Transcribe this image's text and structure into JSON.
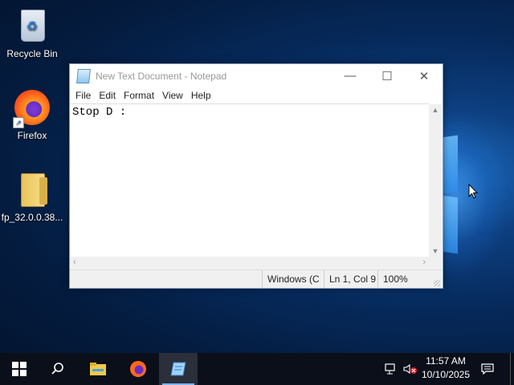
{
  "desktop": {
    "icons": [
      {
        "label": "Recycle Bin",
        "icon": "recycle-bin-icon"
      },
      {
        "label": "Firefox",
        "icon": "firefox-icon"
      },
      {
        "label": "fp_32.0.0.38...",
        "icon": "folder-icon"
      }
    ]
  },
  "notepad": {
    "title": "New Text Document - Notepad",
    "menu": [
      "File",
      "Edit",
      "Format",
      "View",
      "Help"
    ],
    "content": "Stop D :",
    "status": {
      "encoding": "Windows (C",
      "position": "Ln 1, Col 9",
      "zoom": "100%"
    },
    "controls": {
      "minimize": "—",
      "maximize": "☐",
      "close": "✕"
    }
  },
  "taskbar": {
    "buttons": [
      "start-button",
      "search-button",
      "file-explorer-button",
      "firefox-button",
      "notepad-button"
    ],
    "time": "11:57 AM",
    "date": "10/10/2025"
  },
  "colors": {
    "taskbar": "#0a0f1a",
    "accent": "#7ab4ff"
  }
}
